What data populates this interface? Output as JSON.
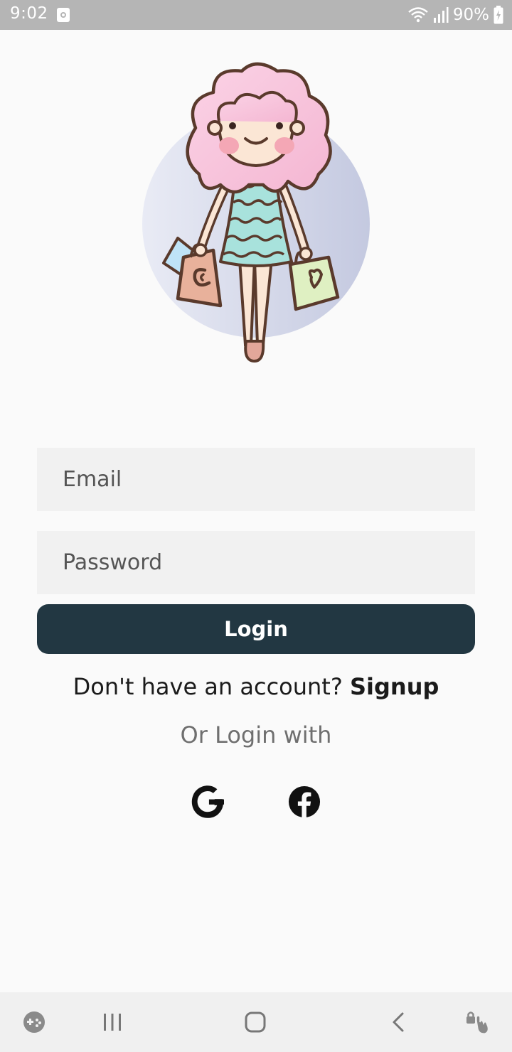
{
  "status_bar": {
    "time": "9:02",
    "battery": "90%",
    "icons": [
      "app-notification-icon",
      "wifi-icon",
      "signal-icon",
      "battery-charging-icon"
    ]
  },
  "form": {
    "email_placeholder": "Email",
    "password_placeholder": "Password",
    "login_label": "Login"
  },
  "signup": {
    "prompt": "Don't have an account?",
    "link": "Signup"
  },
  "social": {
    "heading": "Or Login with",
    "providers": [
      "google-icon",
      "facebook-icon"
    ]
  },
  "nav_bar": {
    "icons": [
      "game-launcher-icon",
      "recents-icon",
      "home-icon",
      "back-icon",
      "touch-lock-icon"
    ]
  },
  "colors": {
    "primary_button": "#223742",
    "input_background": "#f1f1f1",
    "page_background": "#fafafa",
    "status_bar": "#b5b5b5"
  }
}
